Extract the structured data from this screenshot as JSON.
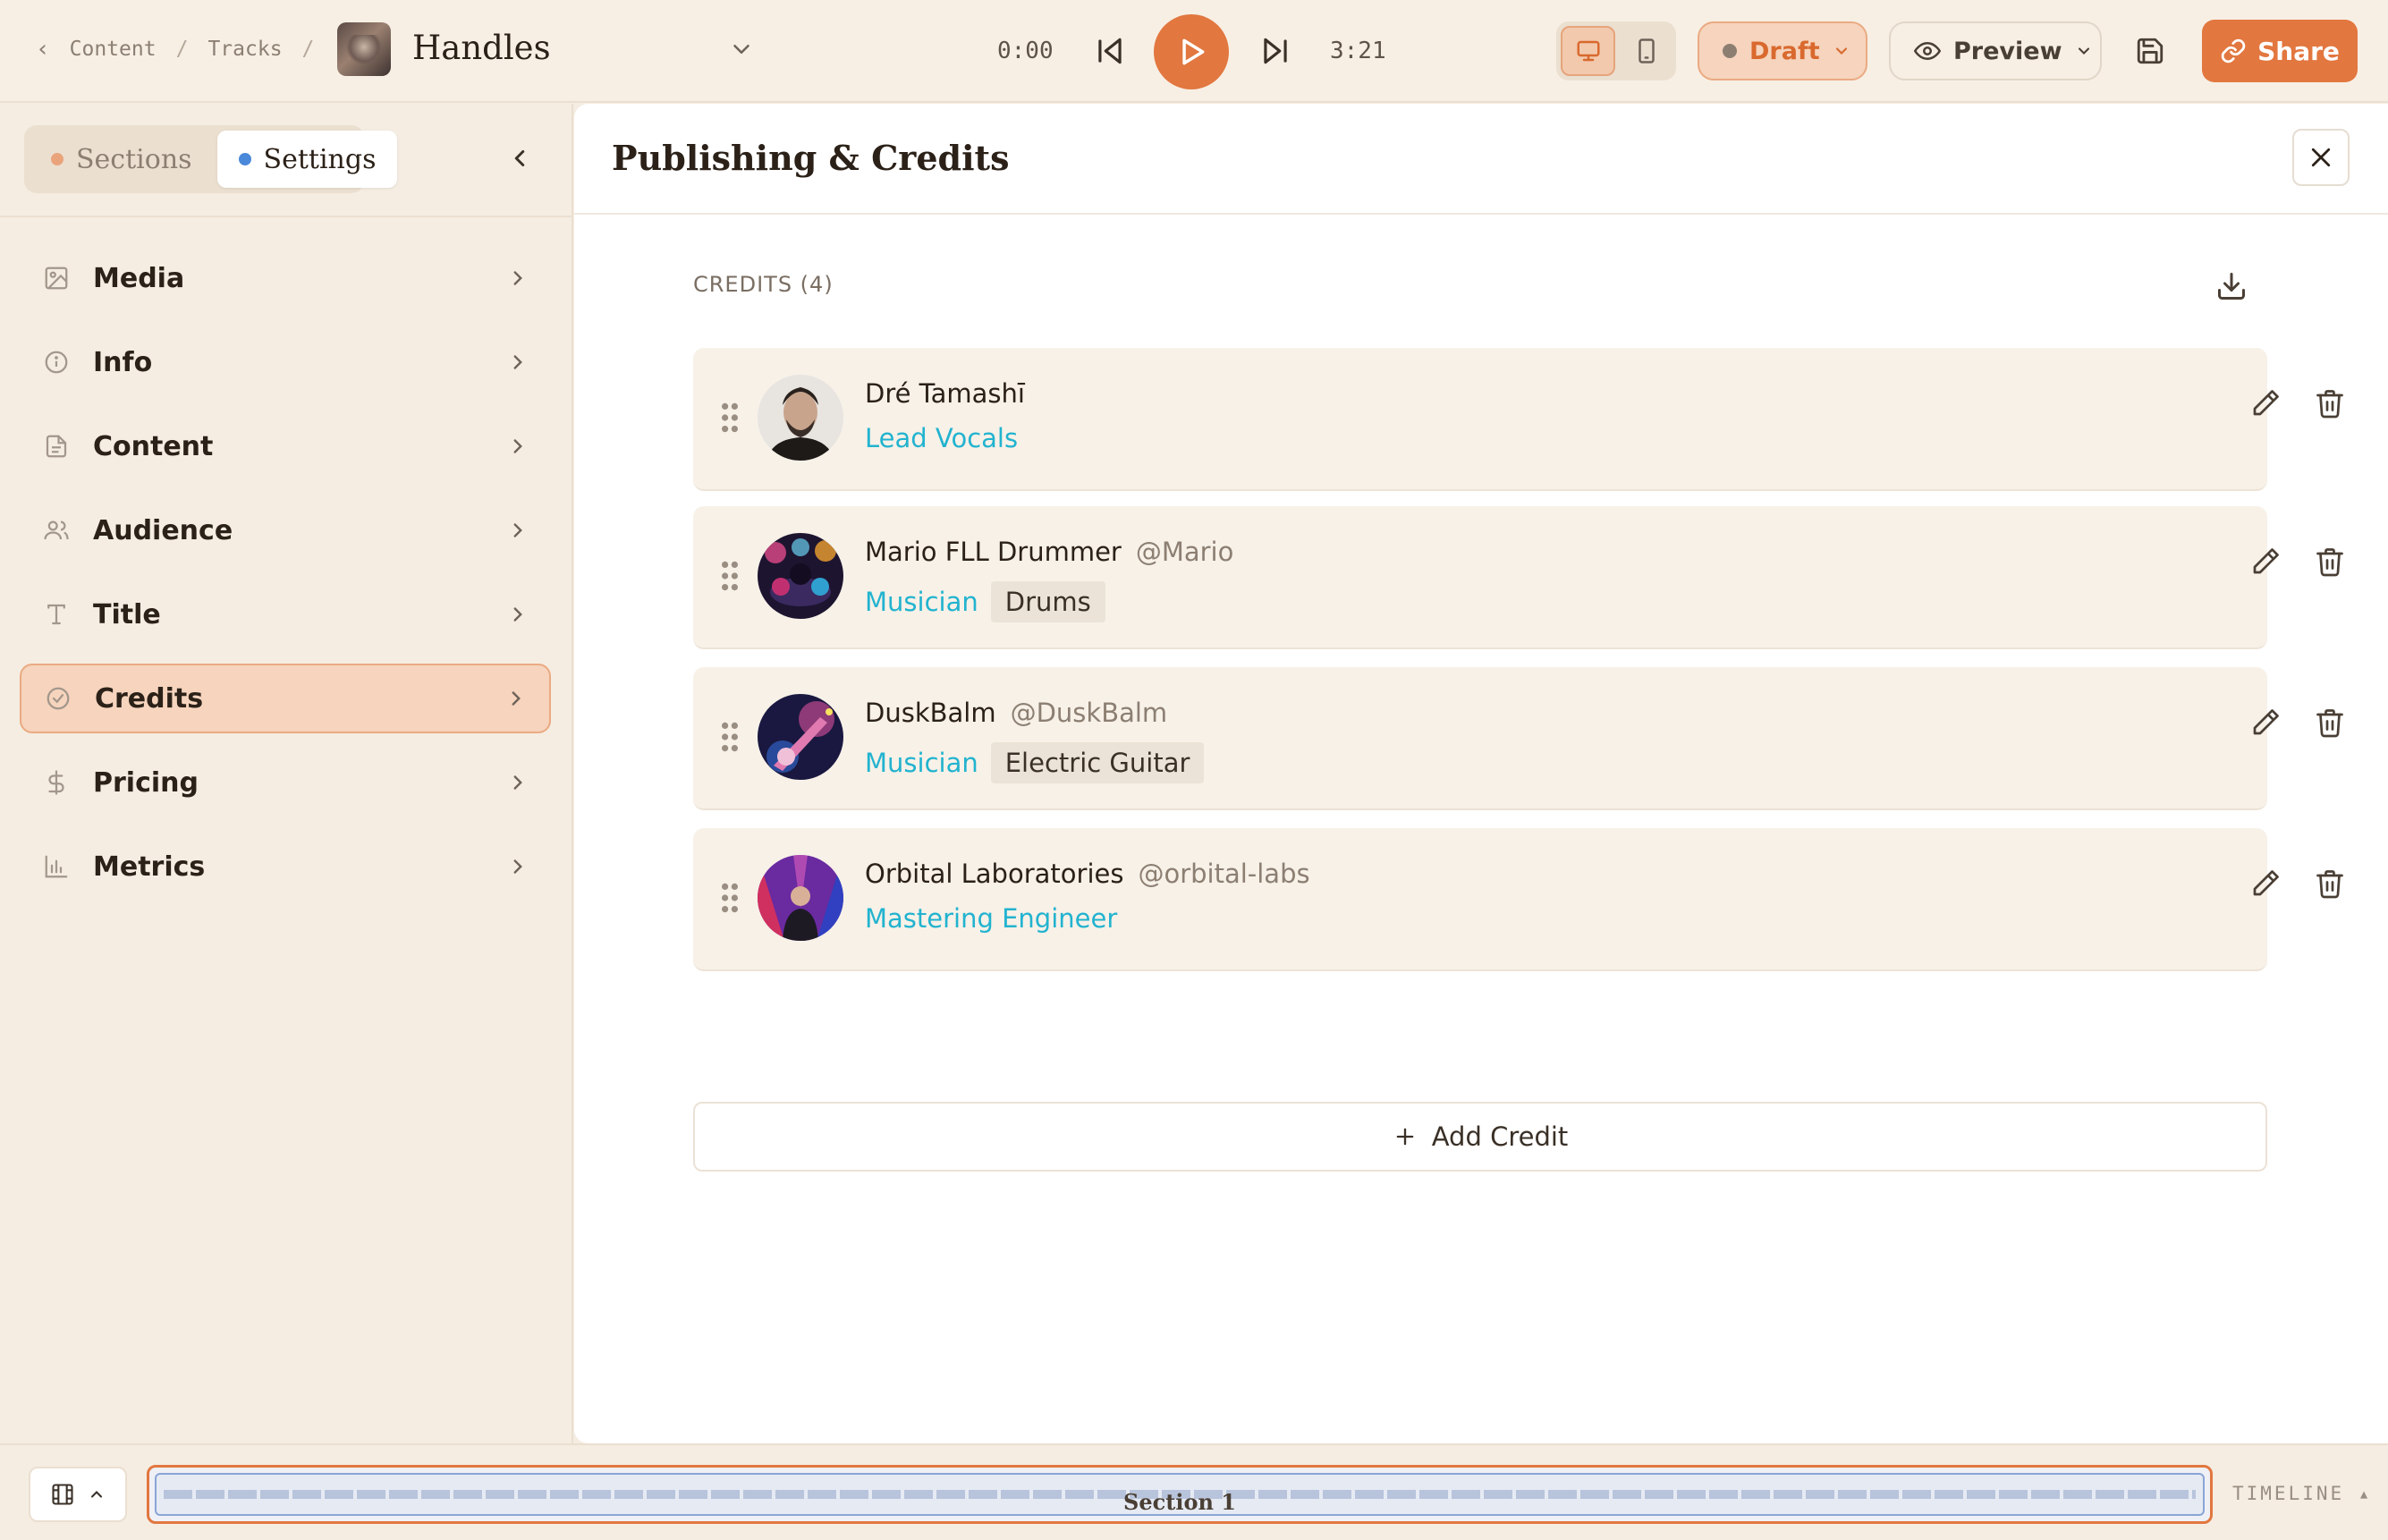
{
  "header": {
    "breadcrumb": [
      "Content",
      "Tracks"
    ],
    "track_title": "Handles",
    "time_current": "0:00",
    "time_total": "3:21",
    "status_label": "Draft",
    "preview_label": "Preview",
    "share_label": "Share"
  },
  "sidebar": {
    "tabs": [
      {
        "label": "Sections",
        "dot_color": "#eaa47c",
        "active": false
      },
      {
        "label": "Settings",
        "dot_color": "#4a88d9",
        "active": true
      }
    ],
    "items": [
      {
        "label": "Media",
        "icon": "image-icon"
      },
      {
        "label": "Info",
        "icon": "info-icon"
      },
      {
        "label": "Content",
        "icon": "document-icon"
      },
      {
        "label": "Audience",
        "icon": "users-icon"
      },
      {
        "label": "Title",
        "icon": "type-icon"
      },
      {
        "label": "Credits",
        "icon": "badge-check-icon",
        "active": true
      },
      {
        "label": "Pricing",
        "icon": "dollar-icon"
      },
      {
        "label": "Metrics",
        "icon": "bar-chart-icon"
      }
    ]
  },
  "panel": {
    "title": "Publishing & Credits",
    "credits_heading": "CREDITS (4)",
    "add_label": "Add Credit",
    "credits": [
      {
        "name": "Dré Tamashī",
        "handle": "",
        "role": "Lead Vocals",
        "tag": ""
      },
      {
        "name": "Mario FLL Drummer",
        "handle": "@Mario",
        "role": "Musician",
        "tag": "Drums"
      },
      {
        "name": "DuskBalm",
        "handle": "@DuskBalm",
        "role": "Musician",
        "tag": "Electric Guitar"
      },
      {
        "name": "Orbital Laboratories",
        "handle": "@orbital-labs",
        "role": "Mastering Engineer",
        "tag": ""
      }
    ]
  },
  "timeline": {
    "section_label": "Section 1",
    "label": "TIMELINE ▴"
  },
  "colors": {
    "accent": "#e2773f",
    "role_text": "#22b3cf",
    "background": "#f5ede2"
  }
}
